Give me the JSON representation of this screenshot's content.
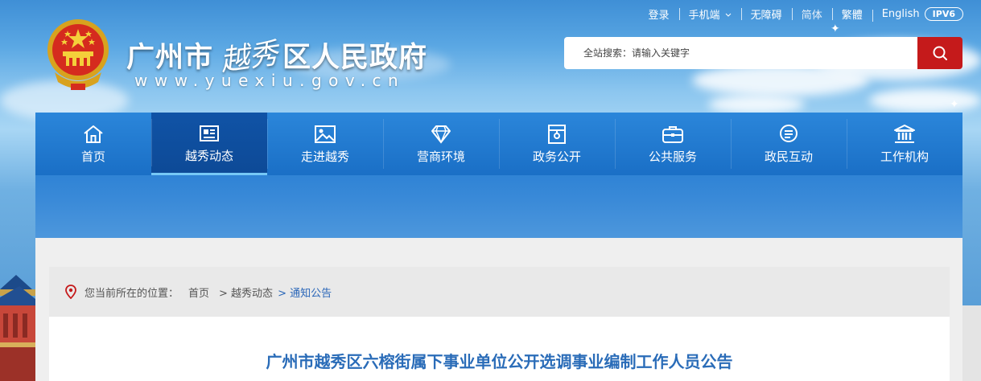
{
  "utility": {
    "login": "登录",
    "mobile": "手机端",
    "accessible": "无障碍",
    "simplified": "简体",
    "traditional": "繁體",
    "english": "English",
    "ipv6": "IPV6"
  },
  "header": {
    "title_left": "广州市",
    "title_callig": "越秀",
    "title_right": "区人民政府",
    "url": "www.yuexiu.gov.cn"
  },
  "search": {
    "placeholder": "全站搜索：请输入关键字"
  },
  "nav": {
    "items": [
      {
        "label": "首页",
        "icon": "home-icon"
      },
      {
        "label": "越秀动态",
        "icon": "newspaper-icon"
      },
      {
        "label": "走进越秀",
        "icon": "image-icon"
      },
      {
        "label": "营商环境",
        "icon": "diamond-icon"
      },
      {
        "label": "政务公开",
        "icon": "folder-icon"
      },
      {
        "label": "公共服务",
        "icon": "briefcase-icon"
      },
      {
        "label": "政民互动",
        "icon": "chat-icon"
      },
      {
        "label": "工作机构",
        "icon": "building-icon"
      }
    ],
    "active_index": 1
  },
  "breadcrumb": {
    "prefix": "您当前所在的位置：",
    "home": "首页",
    "section": "> 越秀动态",
    "current": "> 通知公告"
  },
  "article": {
    "title": "广州市越秀区六榕街属下事业单位公开选调事业编制工作人员公告"
  },
  "colors": {
    "nav_bg": "#1a6fc6",
    "nav_active": "#0d4a97",
    "search_button": "#c51a1b",
    "title_blue": "#2a6cb8"
  }
}
